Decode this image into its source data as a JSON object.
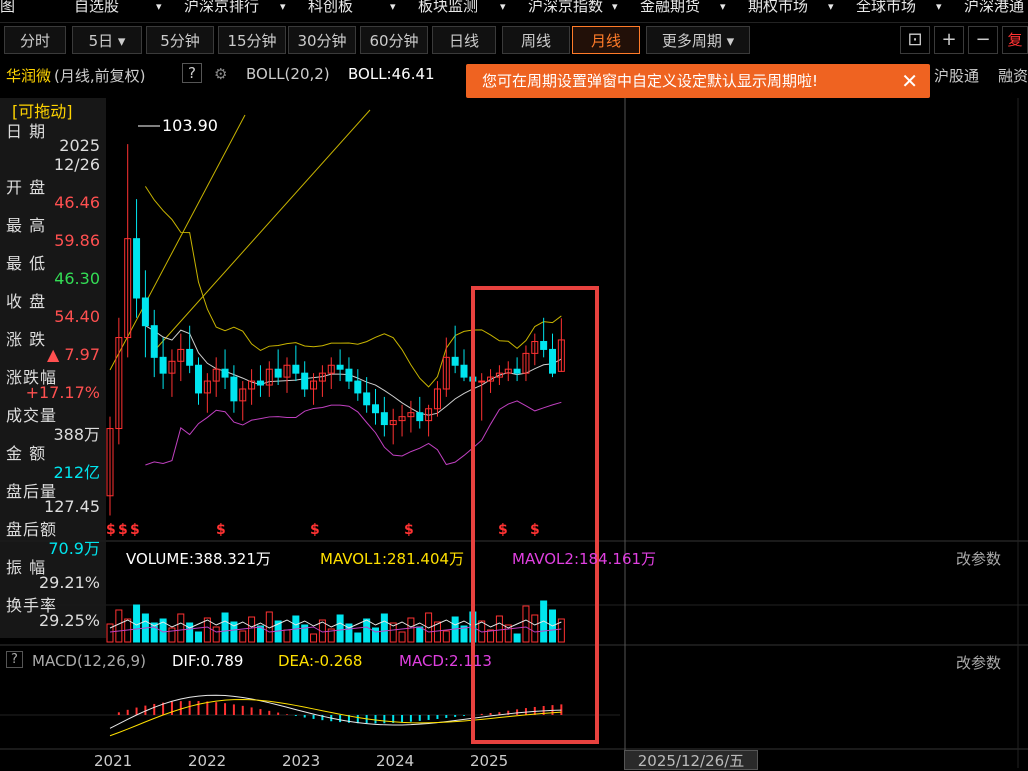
{
  "menu": [
    "图",
    "自选股",
    "沪深京排行",
    "科创板",
    "板块监测",
    "沪深京指数",
    "金融期货",
    "期权市场",
    "全球市场",
    "沪深港通"
  ],
  "periods": {
    "tabs": [
      "分时",
      "5日",
      "5分钟",
      "15分钟",
      "30分钟",
      "60分钟",
      "日线",
      "周线",
      "月线",
      "更多周期"
    ],
    "active": "月线"
  },
  "toolbar": {
    "fu_label": "复"
  },
  "info": {
    "stock_name": "华润微",
    "period_desc": "(月线,前复权)",
    "question": "?",
    "boll_params": "BOLL(20,2)",
    "boll_value": "BOLL:46.41",
    "hgt_label": "沪股通",
    "rz_label": "融资"
  },
  "toast": {
    "message": "您可在周期设置弹窗中自定义设定默认显示周期啦!",
    "close": "✕"
  },
  "price_label": "103.90",
  "panel": {
    "drag_label": "[可拖动]",
    "date_label": "日 期",
    "date_year": "2025",
    "date_md": "12/26",
    "open_label": "开 盘",
    "open": "46.46",
    "high_label": "最 高",
    "high": "59.86",
    "low_label": "最 低",
    "low": "46.30",
    "close_label": "收 盘",
    "close": "54.40",
    "change_label": "涨 跌",
    "change": "▲ 7.97",
    "pct_label": "涨跌幅",
    "pct": "+17.17%",
    "vol_label": "成交量",
    "vol": "388万",
    "amt_label": "金 额",
    "amt": "212亿",
    "ah_vol_label": "盘后量",
    "ah_vol": "127.45",
    "ah_amt_label": "盘后额",
    "ah_amt": "70.9万",
    "amp_label": "振 幅",
    "amp": "29.21%",
    "turn_label": "换手率",
    "turn": "29.25%"
  },
  "volume": {
    "label": "VOLUME:388.321万",
    "mavol1": "MAVOL1:281.404万",
    "mavol2": "MAVOL2:184.161万",
    "edit": "改参数"
  },
  "macd": {
    "params": "MACD(12,26,9)",
    "dif": "DIF:0.789",
    "dea": "DEA:-0.268",
    "macd": "MACD:2.113",
    "edit": "改参数"
  },
  "xaxis": [
    "2021",
    "2022",
    "2023",
    "2024",
    "2025"
  ],
  "cursor_date": "2025/12/26/五",
  "colors": {
    "up": "#ff3232",
    "down": "#00e5ee",
    "accent": "#ff7b29",
    "mid": "#cfcfcf",
    "upper": "#c8b400",
    "lower": "#c040c0"
  },
  "chart_data": {
    "type": "candlestick",
    "ohlc": [
      [
        15,
        35,
        10,
        32
      ],
      [
        32,
        60,
        28,
        55
      ],
      [
        55,
        103.9,
        50,
        80
      ],
      [
        80,
        90,
        60,
        65
      ],
      [
        65,
        72,
        50,
        58
      ],
      [
        58,
        62,
        45,
        50
      ],
      [
        50,
        55,
        42,
        46
      ],
      [
        46,
        52,
        40,
        49
      ],
      [
        49,
        56,
        44,
        52
      ],
      [
        52,
        58,
        46,
        48
      ],
      [
        48,
        50,
        38,
        41
      ],
      [
        41,
        46,
        36,
        44
      ],
      [
        44,
        50,
        40,
        47
      ],
      [
        47,
        52,
        42,
        45
      ],
      [
        45,
        48,
        36,
        39
      ],
      [
        39,
        44,
        34,
        42
      ],
      [
        42,
        47,
        38,
        44
      ],
      [
        44,
        48,
        40,
        43
      ],
      [
        43,
        49,
        40,
        47
      ],
      [
        47,
        52,
        43,
        45
      ],
      [
        45,
        50,
        41,
        48
      ],
      [
        48,
        53,
        44,
        46
      ],
      [
        46,
        49,
        40,
        42
      ],
      [
        42,
        46,
        38,
        44
      ],
      [
        44,
        48,
        40,
        46
      ],
      [
        46,
        50,
        42,
        48
      ],
      [
        48,
        52,
        44,
        47
      ],
      [
        47,
        50,
        42,
        44
      ],
      [
        44,
        47,
        39,
        41
      ],
      [
        41,
        45,
        36,
        38
      ],
      [
        38,
        42,
        33,
        36
      ],
      [
        36,
        40,
        30,
        33
      ],
      [
        33,
        37,
        28,
        34
      ],
      [
        34,
        38,
        30,
        35
      ],
      [
        35,
        39,
        31,
        36
      ],
      [
        36,
        40,
        32,
        34
      ],
      [
        34,
        38,
        30,
        37
      ],
      [
        37,
        44,
        35,
        42
      ],
      [
        42,
        55,
        40,
        50
      ],
      [
        50,
        58,
        46,
        48
      ],
      [
        48,
        52,
        44,
        45
      ],
      [
        45,
        49,
        41,
        44
      ],
      [
        44,
        46,
        34,
        44
      ],
      [
        44,
        47,
        41,
        45
      ],
      [
        45,
        48,
        43,
        46
      ],
      [
        46,
        49,
        44,
        47
      ],
      [
        47,
        50,
        44,
        46
      ],
      [
        46,
        53,
        44,
        51
      ],
      [
        51,
        56,
        48,
        54
      ],
      [
        54,
        60,
        50,
        52
      ],
      [
        52,
        56,
        45,
        46
      ],
      [
        46.46,
        59.86,
        46.3,
        54.4
      ]
    ],
    "first_month": "2020-11",
    "mavol": [],
    "title": "华润微"
  }
}
